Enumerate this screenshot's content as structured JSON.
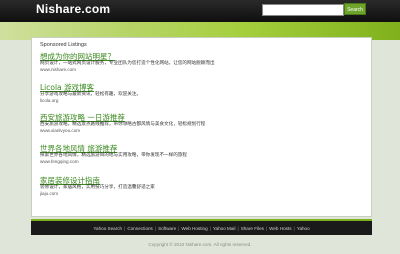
{
  "header": {
    "logo": "Nishare.com",
    "search_placeholder": "",
    "search_button": "Search"
  },
  "main": {
    "heading": "Sponsored Listings",
    "listings": [
      {
        "title": "想成为你的网站明星？",
        "desc": "网页设计，一站式网页设计服务，专业团队为您打造个性化网站，让您的网站脱颖而出",
        "url": "www.nishare.com"
      },
      {
        "title": "Licola 游戏博客",
        "desc": "分享游戏攻略与最新资讯，轻松有趣，欢迎关注。",
        "url": "licola.org"
      },
      {
        "title": "西安旅游攻略 一日游推荐",
        "desc": "西安旅游攻略，精选景点路线推荐，带你领略古都风情与美食文化，轻松规划行程",
        "url": "www.xianlvyou.com"
      },
      {
        "title": "世界各地风情 旅游推荐",
        "desc": "探索世界各地风情，精选旅游目的地与实用攻略，带你发现不一样的旅程",
        "url": "www.fengqing.com"
      },
      {
        "title": "家居装修设计指南",
        "desc": "装修设计，家居风格，实用技巧分享，打造温馨舒适之家",
        "url": "jiaju.com"
      }
    ]
  },
  "footer": {
    "links": [
      "Yahoo Search",
      "Connections",
      "Software",
      "Web Hosting",
      "Yahoo Mail",
      "Share Files",
      "Web Hosts",
      "Yahoo"
    ],
    "copyright": "Copyright © 2010 Nishare.com. All rights reserved."
  },
  "colors": {
    "accent": "#7fb11c",
    "link": "#3a8a1e",
    "topbar": "#1a1a1a"
  }
}
